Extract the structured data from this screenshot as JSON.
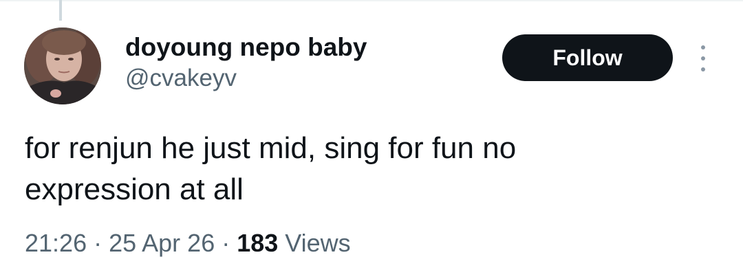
{
  "author": {
    "display_name": "doyoung nepo baby",
    "handle": "@cvakeyv"
  },
  "actions": {
    "follow_label": "Follow",
    "more_icon": "more-vertical-icon"
  },
  "tweet": {
    "line1": "for renjun he just mid, sing for fun no",
    "line2": "expression at all"
  },
  "meta": {
    "time": "21:26",
    "separator1": " · ",
    "date": "25 Apr 26",
    "separator2": " · ",
    "views_count": "183",
    "views_label": " Views"
  },
  "colors": {
    "follow_bg": "#0f1419",
    "secondary_text": "#536471",
    "primary_text": "#0f1419"
  }
}
